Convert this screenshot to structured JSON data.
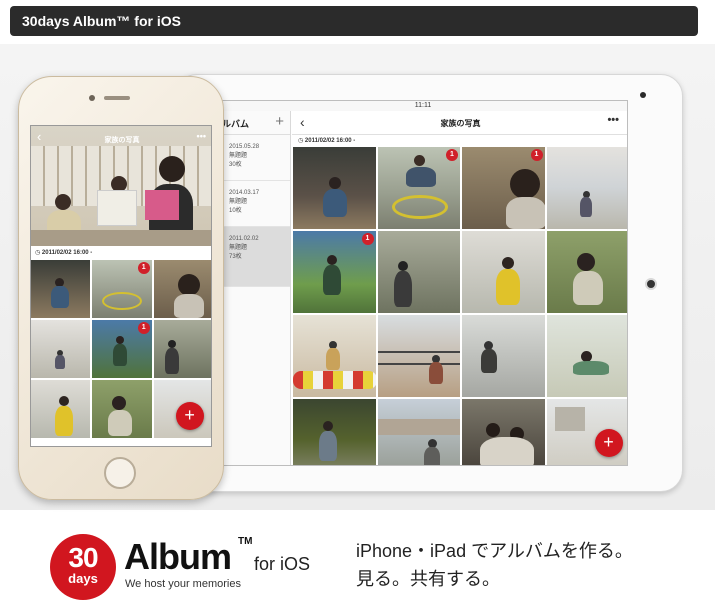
{
  "header": {
    "title": "30days Album™ for iOS"
  },
  "ipad": {
    "status_time": "11:11",
    "sidebar_title": "ルバム",
    "sidebar_add": "+",
    "albums": [
      {
        "date": "2015.05.28",
        "type": "無題題",
        "count": "30枚"
      },
      {
        "date": "2014.03.17",
        "type": "無題題",
        "count": "10枚"
      },
      {
        "date": "2011.02.02",
        "type": "無題題",
        "count": "73枚"
      }
    ],
    "nav_back": "‹",
    "nav_title": "家族の写真",
    "nav_more": "•••",
    "date_row": "◷ 2011/02/02 16:00 -",
    "badges": [
      "1",
      "1",
      "1"
    ],
    "fab": "+"
  },
  "iphone": {
    "nav_back": "‹",
    "nav_title": "家族の写真",
    "nav_more": "•••",
    "date_row": "◷ 2011/02/02 16:00 -",
    "badges": [
      "1",
      "1"
    ],
    "fab": "+"
  },
  "logo": {
    "num": "30",
    "days": "days",
    "word": "Album",
    "tm": "TM",
    "platform": "for iOS",
    "tagline": "We host your memories"
  },
  "tagline_jp": {
    "line1": "iPhone・iPad でアルバムを作る。",
    "line2": "見る。共有する。"
  },
  "colors": {
    "accent": "#d1161f",
    "header_bg": "#2b2b2b"
  }
}
